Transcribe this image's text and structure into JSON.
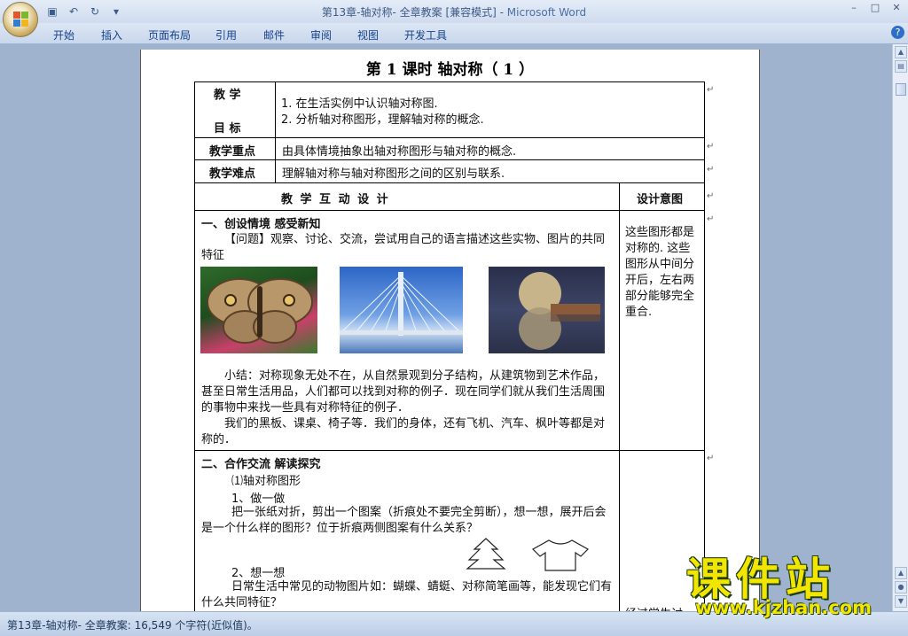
{
  "window": {
    "doc_title": "第13章-轴对称- 全章教案 [兼容模式] - ",
    "app_name": "Microsoft Word",
    "controls": [
      "–",
      "□",
      "✕"
    ]
  },
  "quick_access": {
    "save": "▣",
    "undo": "↶",
    "redo": "↻",
    "customize": "▾"
  },
  "ribbon_tabs": [
    "开始",
    "插入",
    "页面布局",
    "引用",
    "邮件",
    "审阅",
    "视图",
    "开发工具"
  ],
  "help_label": "?",
  "doc": {
    "heading": "第 1 课时  轴对称（ 1 ）",
    "row_goal": {
      "label_1": "教    学",
      "label_2": "目    标",
      "line_1": "1. 在生活实例中认识轴对称图.",
      "line_2": "2. 分析轴对称图形，理解轴对称的概念."
    },
    "row_key": {
      "label": "教学重点",
      "text": "由具体情境抽象出轴对称图形与轴对称的概念."
    },
    "row_difficulty": {
      "label": "教学难点",
      "text": "理解轴对称与轴对称图形之间的区别与联系."
    },
    "design_header": "教    学    互    动    设    计",
    "intent_header": "设计意图",
    "section1": {
      "title": "一、创设情境   感受新知",
      "question": "【问题】观察、讨论、交流，尝试用自己的语言描述这些实物、图片的共同特征",
      "summary": "小结：对称现象无处不在，从自然景观到分子结构，从建筑物到艺术作品，甚至日常生活用品，人们都可以找到对称的例子．现在同学们就从我们生活周围的事物中来找一些具有对称特征的例子．",
      "examples": "我们的黑板、课桌、椅子等．我们的身体，还有飞机、汽车、枫叶等都是对称的．",
      "intent": "这些图形都是对称的. 这些图形从中间分开后，左右两部分能够完全重合."
    },
    "section2": {
      "title": "二、合作交流   解读探究",
      "sub1": "⑴轴对称图形",
      "step1": "1、做一做",
      "step1_text": "把一张纸对折，剪出一个图案（折痕处不要完全剪断），想一想，展开后会是一个什么样的图形？位于折痕两侧图案有什么关系？",
      "step2": "2、想一想",
      "step2_text": "日常生活中常见的动物图片如：蝴蝶、蜻蜓、对称简笔画等，能发现它们有什么共同特征？",
      "intent_tail": "经过学生讨"
    }
  },
  "status_bar": "第13章-轴对称- 全章教案: 16,549 个字符(近似值)。",
  "watermark": {
    "big": "课件站",
    "url": "www.kjzhan.com"
  }
}
